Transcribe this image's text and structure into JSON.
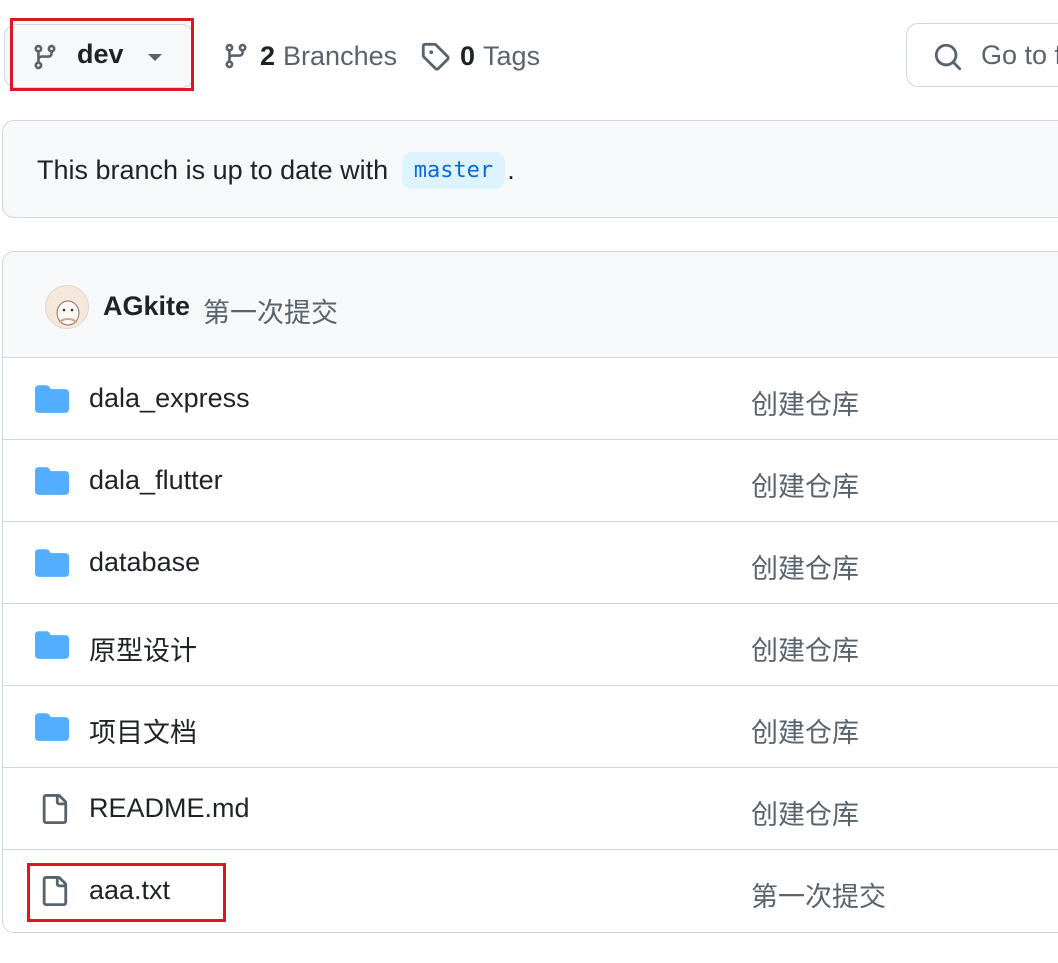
{
  "branch": {
    "current": "dev"
  },
  "branches": {
    "count": "2",
    "label": "Branches"
  },
  "tags": {
    "count": "0",
    "label": "Tags"
  },
  "search": {
    "placeholder": "Go to file"
  },
  "banner": {
    "prefix": "This branch is up to date with",
    "base_branch": "master",
    "suffix": "."
  },
  "latest_commit": {
    "author": "AGkite",
    "message": "第一次提交"
  },
  "files": [
    {
      "name": "dala_express",
      "type": "folder",
      "message": "创建仓库"
    },
    {
      "name": "dala_flutter",
      "type": "folder",
      "message": "创建仓库"
    },
    {
      "name": "database",
      "type": "folder",
      "message": "创建仓库"
    },
    {
      "name": "原型设计",
      "type": "folder",
      "message": "创建仓库"
    },
    {
      "name": "项目文档",
      "type": "folder",
      "message": "创建仓库"
    },
    {
      "name": "README.md",
      "type": "file",
      "message": "创建仓库"
    },
    {
      "name": "aaa.txt",
      "type": "file",
      "message": "第一次提交"
    }
  ],
  "colors": {
    "accent": "#0969da",
    "folder": "#54aeff",
    "highlight": "#e0151f",
    "muted": "#59636e"
  }
}
